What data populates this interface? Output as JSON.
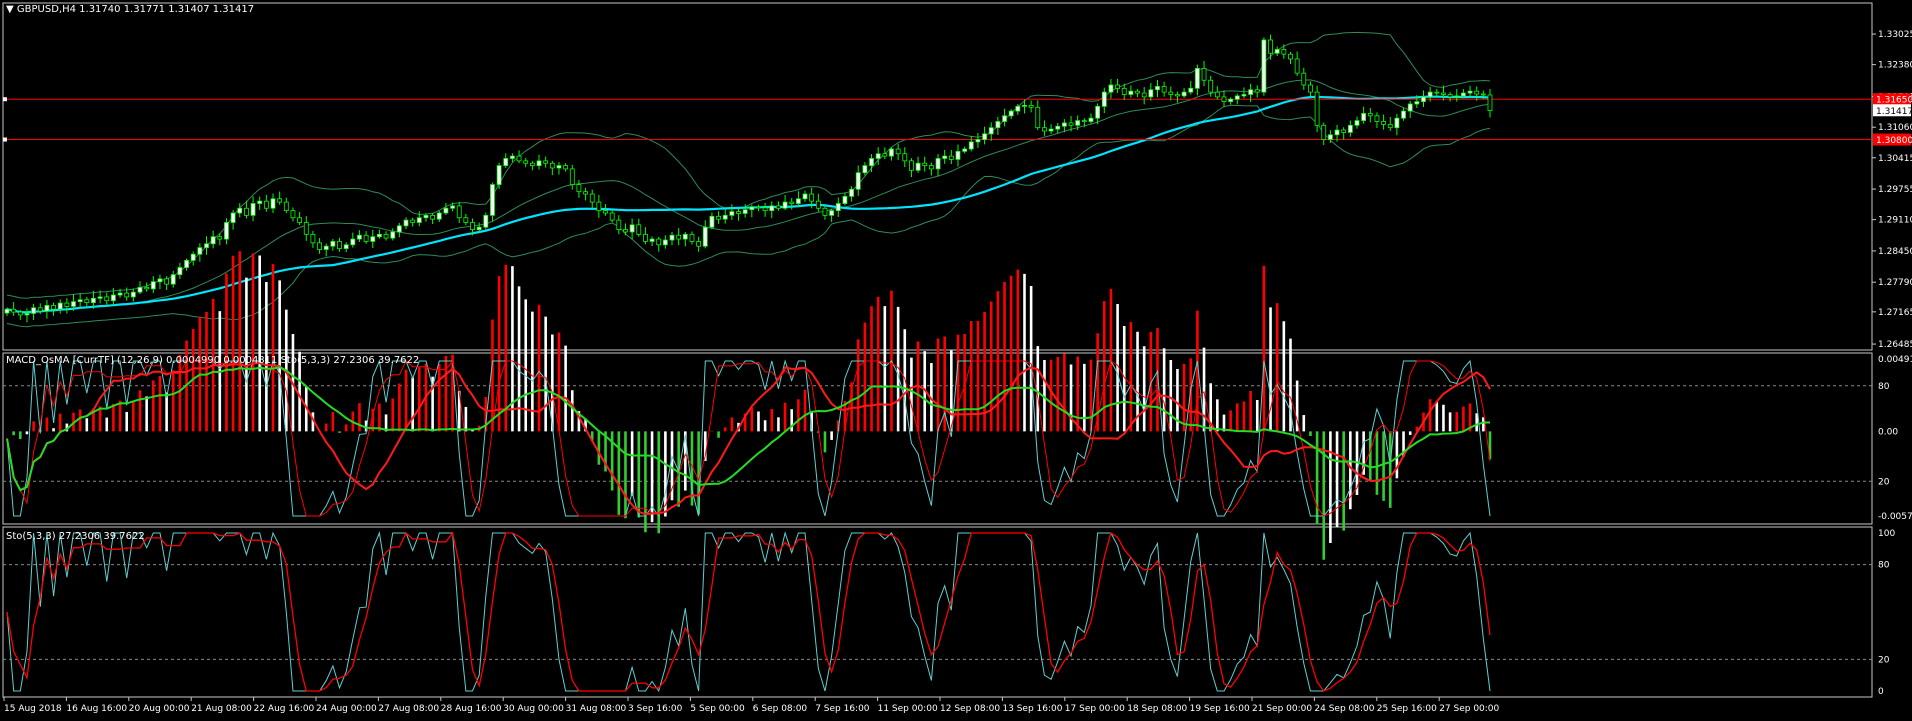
{
  "header": {
    "symbol": "GBPUSD,H4",
    "ohlc": "1.31740 1.31771 1.31407 1.31417",
    "macd_title": "MACD_OsMA [CurrTF] (12,26,9) 0.0004990 0.0004811  Sto(5,3,3) 27.2306 39.7622",
    "sto_title": "Sto(5,3,3) 27.2306 39.7622"
  },
  "colors": {
    "bull": "#00ff00",
    "bull_body": "#ffffff",
    "bear": "#00ff00",
    "bear_body": "#000000",
    "ma": "#00e5ff",
    "bands": "#2e8b57",
    "hline": "#ff0000",
    "macd_pos": "#ff0000",
    "macd_neg": "#33cc33",
    "macd_fade": "#ffffff",
    "sto_main": "#5fd0d0",
    "sto_sig": "#ff0000",
    "macd_fast": "#ff1a1a",
    "macd_slow": "#22dd22"
  },
  "chart_data": [
    {
      "type": "candlestick",
      "panel": "price",
      "ylim": [
        1.2636,
        1.3368
      ],
      "y_ticks": [
        "1.33025",
        "1.32380",
        "1.31705",
        "1.31060",
        "1.30415",
        "1.29755",
        "1.29110",
        "1.28450",
        "1.27790",
        "1.27165",
        "1.26485"
      ],
      "y_tick_values": [
        1.33025,
        1.3238,
        1.31705,
        1.3106,
        1.30415,
        1.29755,
        1.2911,
        1.2845,
        1.2779,
        1.27165,
        1.26485
      ],
      "price_tags": [
        {
          "label": "1.31650",
          "value": 1.3165,
          "style": "red"
        },
        {
          "label": "1.31417",
          "value": 1.31417,
          "style": "white"
        },
        {
          "label": "1.30800",
          "value": 1.308,
          "style": "red"
        }
      ],
      "horizontal_lines": [
        1.3165,
        1.308
      ],
      "x_labels": [
        "15 Aug 2018",
        "16 Aug 16:00",
        "20 Aug 00:00",
        "21 Aug 08:00",
        "22 Aug 16:00",
        "24 Aug 00:00",
        "27 Aug 08:00",
        "28 Aug 16:00",
        "30 Aug 00:00",
        "31 Aug 08:00",
        "3 Sep 16:00",
        "5 Sep 00:00",
        "6 Sep 08:00",
        "7 Sep 16:00",
        "11 Sep 00:00",
        "12 Sep 08:00",
        "13 Sep 16:00",
        "17 Sep 00:00",
        "18 Sep 08:00",
        "19 Sep 16:00",
        "21 Sep 00:00",
        "24 Sep 08:00",
        "25 Sep 16:00",
        "27 Sep 00:00"
      ],
      "close": [
        1.2722,
        1.2716,
        1.271,
        1.2713,
        1.2725,
        1.2718,
        1.273,
        1.2722,
        1.2735,
        1.2728,
        1.2738,
        1.2742,
        1.2736,
        1.2745,
        1.2748,
        1.274,
        1.2752,
        1.2756,
        1.2748,
        1.2758,
        1.2768,
        1.2765,
        1.278,
        1.2786,
        1.2775,
        1.2795,
        1.281,
        1.2825,
        1.2838,
        1.2852,
        1.286,
        1.2875,
        1.287,
        1.2905,
        1.2925,
        1.2935,
        1.292,
        1.2945,
        1.295,
        1.2935,
        1.2955,
        1.2948,
        1.293,
        1.2915,
        1.2905,
        1.288,
        1.2862,
        1.2848,
        1.2855,
        1.2865,
        1.285,
        1.2858,
        1.287,
        1.2878,
        1.2865,
        1.2875,
        1.288,
        1.2872,
        1.2885,
        1.2898,
        1.291,
        1.2905,
        1.2915,
        1.292,
        1.2912,
        1.2925,
        1.2935,
        1.294,
        1.2915,
        1.2905,
        1.289,
        1.2895,
        1.292,
        1.2985,
        1.3025,
        1.304,
        1.3045,
        1.3035,
        1.303,
        1.3025,
        1.3035,
        1.303,
        1.302,
        1.3025,
        1.3018,
        1.2985,
        1.297,
        1.2965,
        1.2948,
        1.293,
        1.2925,
        1.291,
        1.289,
        1.2885,
        1.29,
        1.288,
        1.2865,
        1.287,
        1.2858,
        1.2868,
        1.2878,
        1.287,
        1.288,
        1.2865,
        1.2855,
        1.2895,
        1.2918,
        1.2912,
        1.292,
        1.2928,
        1.2924,
        1.2932,
        1.2938,
        1.2936,
        1.293,
        1.294,
        1.2935,
        1.2948,
        1.2945,
        1.2955,
        1.2965,
        1.295,
        1.2935,
        1.292,
        1.293,
        1.2945,
        1.296,
        1.2975,
        1.301,
        1.3025,
        1.304,
        1.305,
        1.3045,
        1.306,
        1.305,
        1.3035,
        1.3015,
        1.303,
        1.3025,
        1.3018,
        1.304,
        1.3045,
        1.3038,
        1.3055,
        1.306,
        1.3075,
        1.308,
        1.3092,
        1.3105,
        1.3118,
        1.313,
        1.314,
        1.315,
        1.3152,
        1.3148,
        1.3105,
        1.3098,
        1.3102,
        1.3108,
        1.3115,
        1.311,
        1.312,
        1.3118,
        1.3125,
        1.315,
        1.318,
        1.3195,
        1.3188,
        1.3175,
        1.3182,
        1.3178,
        1.317,
        1.3185,
        1.3192,
        1.318,
        1.3175,
        1.3172,
        1.318,
        1.3188,
        1.323,
        1.3205,
        1.318,
        1.317,
        1.316,
        1.3165,
        1.3172,
        1.3175,
        1.3185,
        1.318,
        1.329,
        1.3262,
        1.327,
        1.326,
        1.325,
        1.322,
        1.3195,
        1.318,
        1.311,
        1.308,
        1.309,
        1.31,
        1.3095,
        1.311,
        1.312,
        1.3135,
        1.313,
        1.3118,
        1.3112,
        1.3105,
        1.3125,
        1.314,
        1.3155,
        1.316,
        1.317,
        1.318,
        1.3178,
        1.3175,
        1.317,
        1.3172,
        1.3178,
        1.3182,
        1.3176,
        1.3174,
        1.3141
      ],
      "bands_period": 20,
      "ma_period": 50
    },
    {
      "type": "histogram+lines",
      "panel": "macd",
      "y_ticks": [
        "0.004913",
        "80",
        "0.00",
        "20",
        "-0.005734"
      ],
      "y_tick_values": [
        0.004913,
        80,
        0,
        20,
        -0.005734
      ],
      "levels": [
        80,
        20
      ],
      "values": {
        "macd_osma": 0.000499,
        "signal": 0.0004811,
        "sto_main": 27.2306,
        "sto_signal": 39.7622
      }
    },
    {
      "type": "line",
      "panel": "stochastic",
      "ylim": [
        0,
        100
      ],
      "y_ticks": [
        "100",
        "80",
        "20",
        "0"
      ],
      "y_tick_values": [
        100,
        80,
        20,
        0
      ],
      "levels": [
        80,
        20
      ],
      "values": {
        "main": 27.2306,
        "signal": 39.7622
      }
    }
  ]
}
